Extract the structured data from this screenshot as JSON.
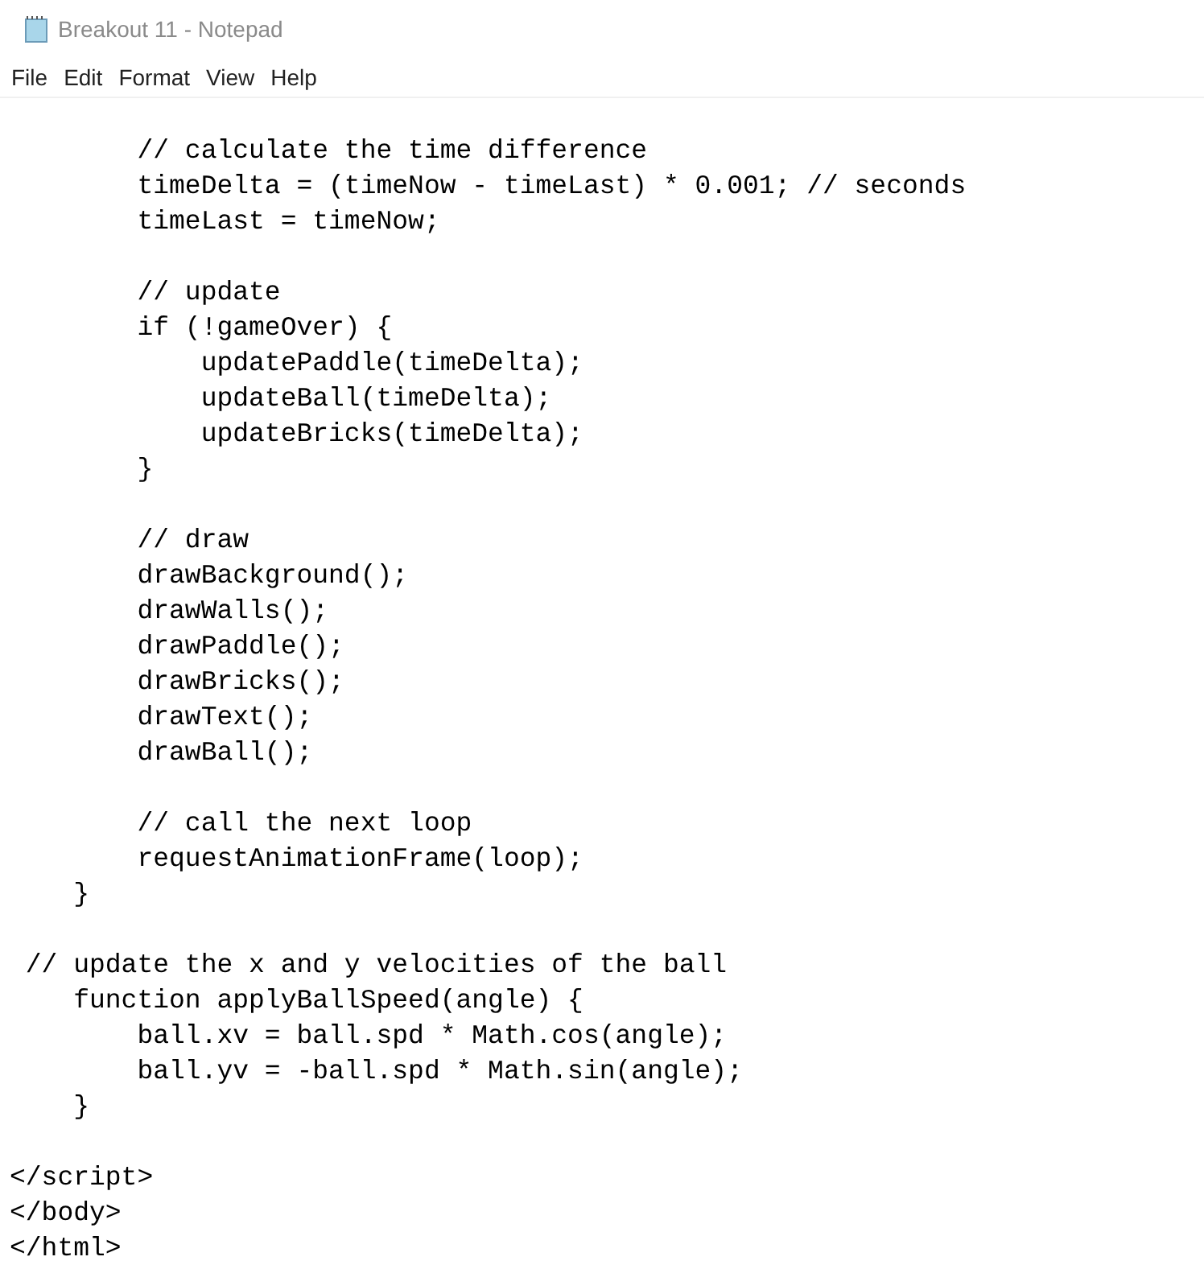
{
  "window": {
    "title": "Breakout 11 - Notepad"
  },
  "menu": [
    "File",
    "Edit",
    "Format",
    "View",
    "Help"
  ],
  "editor": {
    "blocks": [
      [
        "        // calculate the time difference",
        "        timeDelta = (timeNow - timeLast) * 0.001; // seconds",
        "        timeLast = timeNow;"
      ],
      [
        "        // update",
        "        if (!gameOver) {",
        "            updatePaddle(timeDelta);",
        "            updateBall(timeDelta);",
        "            updateBricks(timeDelta);",
        "        }"
      ],
      [
        "        // draw",
        "        drawBackground();",
        "        drawWalls();",
        "        drawPaddle();",
        "        drawBricks();",
        "        drawText();",
        "        drawBall();"
      ],
      [
        "        // call the next loop",
        "        requestAnimationFrame(loop);",
        "    }"
      ],
      [
        " // update the x and y velocities of the ball",
        "    function applyBallSpeed(angle) {",
        "        ball.xv = ball.spd * Math.cos(angle);",
        "        ball.yv = -ball.spd * Math.sin(angle);",
        "    }"
      ],
      [
        "</script>",
        "</body>",
        "</html>"
      ]
    ]
  }
}
